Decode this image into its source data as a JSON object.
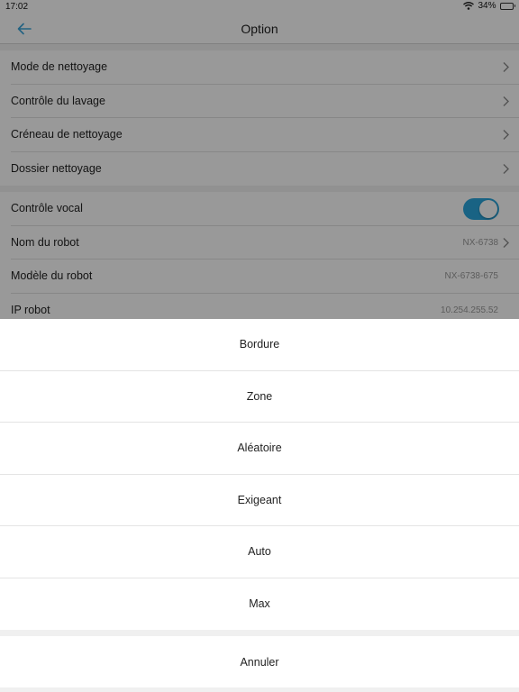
{
  "status_bar": {
    "time": "17:02",
    "battery": "34%"
  },
  "nav": {
    "title": "Option"
  },
  "settings_group_1": [
    {
      "label": "Mode de nettoyage"
    },
    {
      "label": "Contrôle du lavage"
    },
    {
      "label": "Créneau de nettoyage"
    },
    {
      "label": "Dossier nettoyage"
    }
  ],
  "settings_group_2": [
    {
      "label": "Contrôle vocal"
    },
    {
      "label": "Nom du robot",
      "value": "NX-6738"
    },
    {
      "label": "Modèle du robot",
      "value": "NX-6738-675"
    },
    {
      "label": "IP robot",
      "value": "10.254.255.52"
    }
  ],
  "voice_control": {
    "enabled": true
  },
  "action_sheet": {
    "options": [
      "Bordure",
      "Zone",
      "Aléatoire",
      "Exigeant",
      "Auto",
      "Max"
    ],
    "cancel": "Annuler"
  },
  "colors": {
    "accent": "#2aa6dc",
    "back_arrow": "#3aa3d8"
  }
}
